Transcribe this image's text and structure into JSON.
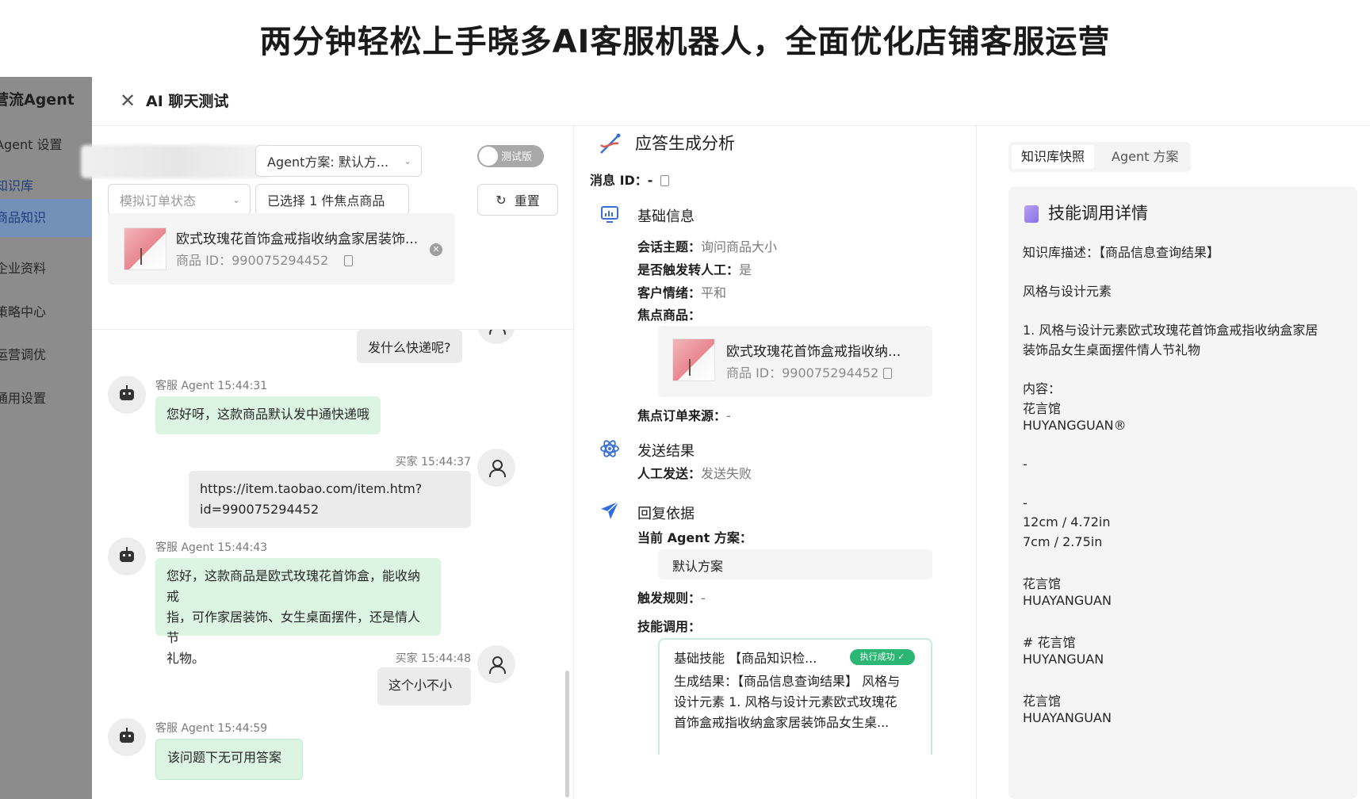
{
  "banner": {
    "title": "两分钟轻松上手晓多AI客服机器人，全面优化店铺客服运营"
  },
  "sidebar": {
    "brand": "营流Agent",
    "items": [
      {
        "label": "Agent 设置"
      },
      {
        "label": "知识库"
      },
      {
        "label": "商品知识"
      },
      {
        "label": "企业资料"
      },
      {
        "label": "策略中心"
      },
      {
        "label": "运营调优"
      },
      {
        "label": "通用设置"
      }
    ]
  },
  "modal": {
    "title": "AI 聊天测试",
    "controls": {
      "agent_plan": "Agent方案: 默认方...",
      "test_toggle": "测试版",
      "order_state_placeholder": "模拟订单状态",
      "focus_product": "已选择 1 件焦点商品",
      "reset": "重置"
    },
    "product": {
      "title": "欧式玫瑰花首饰盒戒指收纳盒家居装饰...",
      "id_text": "商品 ID：990075294452"
    },
    "chat": {
      "messages": [
        {
          "role": "user",
          "text": "发什么快递呢?"
        },
        {
          "role": "agent",
          "meta": "客服 Agent 15:44:31",
          "text": "您好呀，这款商品默认发中通快递哦"
        },
        {
          "role": "user",
          "meta": "买家 15:44:37",
          "line1": "https://item.taobao.com/item.htm?",
          "line2": "id=990075294452"
        },
        {
          "role": "agent",
          "meta": "客服 Agent 15:44:43",
          "line1": "您好，这款商品是欧式玫瑰花首饰盒，能收纳戒",
          "line2": "指，可作家居装饰、女生桌面摆件，还是情人节",
          "line3": "礼物。"
        },
        {
          "role": "user",
          "meta": "买家 15:44:48",
          "text": "这个小不小"
        },
        {
          "role": "agent",
          "meta": "客服 Agent 15:44:59",
          "text": "该问题下无可用答案"
        }
      ]
    }
  },
  "analysis": {
    "title": "应答生成分析",
    "message_id": "消息 ID：-",
    "basic": {
      "heading": "基础信息",
      "topic_k": "会话主题：",
      "topic_v": "询问商品大小",
      "transfer_k": "是否触发转人工：",
      "transfer_v": "是",
      "emotion_k": "客户情绪：",
      "emotion_v": "平和",
      "focus_k": "焦点商品：",
      "focus_title": "欧式玫瑰花首饰盒戒指收纳...",
      "focus_id": "商品 ID：990075294452",
      "order_src_k": "焦点订单来源：",
      "order_src_v": "-"
    },
    "send": {
      "heading": "发送结果",
      "manual_k": "人工发送：",
      "manual_v": "发送失败"
    },
    "basis": {
      "heading": "回复依据",
      "current_plan_k": "当前 Agent 方案：",
      "current_plan_v": "默认方案",
      "trigger_k": "触发规则：",
      "trigger_v": "-",
      "skill_k": "技能调用：",
      "skill_name": "基础技能 【商品知识检...",
      "skill_status": "执行成功 ✓",
      "skill_line1": "生成结果：【商品信息查询结果】 风格与",
      "skill_line2": "设计元素 1. 风格与设计元素欧式玫瑰花",
      "skill_line3": "首饰盒戒指收纳盒家居装饰品女生桌..."
    }
  },
  "right": {
    "tabs": [
      "知识库快照",
      "Agent 方案"
    ],
    "detail_title": "技能调用详情",
    "lines": [
      "知识库描述：【商品信息查询结果】",
      "风格与设计元素",
      "1. 风格与设计元素欧式玫瑰花首饰盒戒指收纳盒家居",
      "装饰品女生桌面摆件情人节礼物",
      "内容：",
      "花言馆",
      "HUYANGGUAN®",
      "-",
      "-",
      "12cm / 4.72in",
      "7cm / 2.75in",
      "花言馆",
      "HUAYANGUAN",
      "# 花言馆",
      "HUYANGUAN",
      "花言馆",
      "HUAYANGUAN"
    ]
  }
}
